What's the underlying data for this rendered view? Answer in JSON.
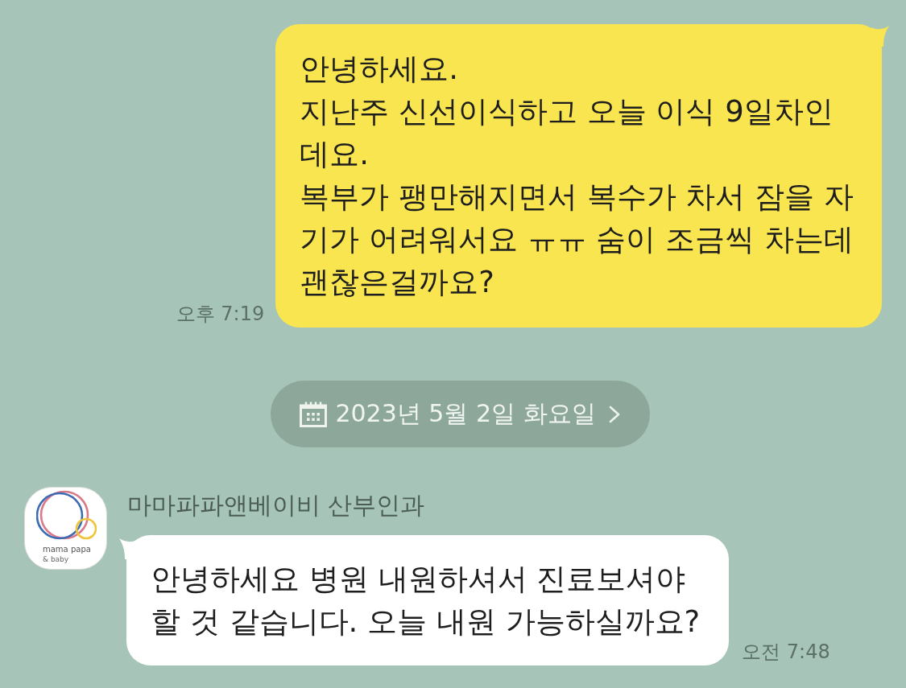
{
  "chat": [
    {
      "kind": "sent",
      "text": "안녕하세요.\n지난주 신선이식하고 오늘 이식 9일차인\n데요.\n복부가 팽만해지면서 복수가 차서 잠을 자\n기가 어려워서요 ㅠㅠ 숨이 조금씩 차는데\n괜찮은걸까요?",
      "time": "오후 7:19"
    },
    {
      "kind": "date",
      "label": "2023년 5월 2일 화요일"
    },
    {
      "kind": "received",
      "sender": "마마파파앤베이비 산부인과",
      "avatar": {
        "logo_lines": [
          "mama papa",
          "& baby"
        ]
      },
      "text": "안녕하세요 병원 내원하셔서 진료보셔야\n할 것 같습니다. 오늘 내원 가능하실까요?",
      "time": "오전 7:48"
    }
  ]
}
